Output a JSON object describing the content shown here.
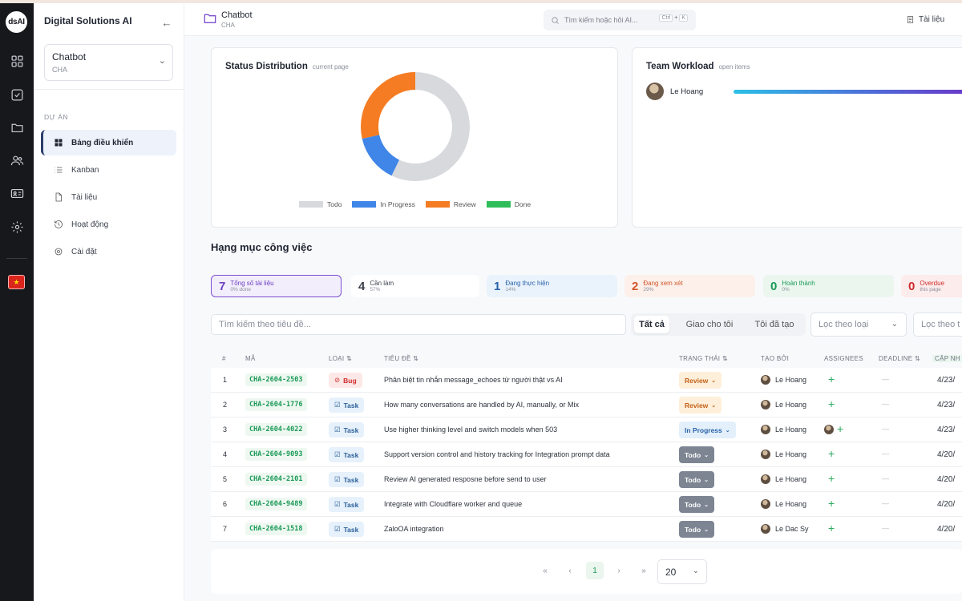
{
  "rail": {
    "logo": "dsAI",
    "icons": [
      "grid-icon",
      "check-square-icon",
      "folder-icon",
      "users-icon",
      "id-card-icon",
      "settings-icon"
    ],
    "flag": "vietnam-flag-icon"
  },
  "sidebar": {
    "org_name": "Digital Solutions AI",
    "project": {
      "name": "Chatbot",
      "code": "CHA"
    },
    "section_label": "DỰ ÁN",
    "items": [
      {
        "label": "Bảng điều khiển",
        "icon": "dashboard-icon",
        "active": true
      },
      {
        "label": "Kanban",
        "icon": "list-icon"
      },
      {
        "label": "Tài liệu",
        "icon": "document-icon"
      },
      {
        "label": "Hoạt động",
        "icon": "history-icon"
      },
      {
        "label": "Cài đặt",
        "icon": "gear-icon"
      }
    ]
  },
  "topbar": {
    "title": "Chatbot",
    "subtitle": "CHA",
    "search_placeholder": "Tìm kiếm hoặc hỏi AI...",
    "kbd": [
      "Ctrl",
      "+",
      "K"
    ],
    "docs_label": "Tài liệu"
  },
  "status_card": {
    "title": "Status Distribution",
    "subtitle": "current page"
  },
  "workload_card": {
    "title": "Team Workload",
    "subtitle": "open items",
    "rows": [
      {
        "name": "Le Hoang",
        "fraction": 1.0
      }
    ]
  },
  "chart_data": {
    "type": "pie",
    "title": "Status Distribution",
    "categories": [
      "Todo",
      "In Progress",
      "Review",
      "Done"
    ],
    "values": [
      4,
      1,
      2,
      0
    ],
    "colors": [
      "#d7d9dd",
      "#3f86e8",
      "#f57c23",
      "#2fbd5a"
    ],
    "legend": "bottom"
  },
  "section": {
    "title": "Hạng mục công việc"
  },
  "stats": [
    {
      "num": "7",
      "label": "Tổng số tài liệu",
      "sub": "0% done",
      "color": "#6b3fc0"
    },
    {
      "num": "4",
      "label": "Cần làm",
      "sub": "57%",
      "color": "#3a3f4a"
    },
    {
      "num": "1",
      "label": "Đang thực hiện",
      "sub": "14%",
      "color": "#2a62a8"
    },
    {
      "num": "2",
      "label": "Đang xem xét",
      "sub": "29%",
      "color": "#d1552a"
    },
    {
      "num": "0",
      "label": "Hoàn thành",
      "sub": "0%",
      "color": "#1b9a57"
    },
    {
      "num": "0",
      "label": "Overdue",
      "sub": "this page",
      "color": "#d12b2b"
    }
  ],
  "filters": {
    "search_placeholder": "Tìm kiếm theo tiêu đề...",
    "tabs": [
      "Tất cả",
      "Giao cho tôi",
      "Tôi đã tạo"
    ],
    "type_placeholder": "Lọc theo loại",
    "other_placeholder": "Lọc theo t"
  },
  "table": {
    "headers": [
      "#",
      "MÃ",
      "LOẠI ⇅",
      "TIÊU ĐỀ ⇅",
      "TRẠNG THÁI ⇅",
      "TẠO BỞI",
      "ASSIGNEES",
      "DEADLINE ⇅",
      "CẬP NH"
    ],
    "rows": [
      {
        "n": "1",
        "code": "CHA-2604-2503",
        "type": "Bug",
        "title": "Phân biệt tin nhắn message_echoes từ người thật vs AI",
        "status": "Review",
        "creator": "Le Hoang",
        "assignee": false,
        "deadline": "—",
        "updated": "4/23/"
      },
      {
        "n": "2",
        "code": "CHA-2604-1776",
        "type": "Task",
        "title": "How many conversations are handled by AI, manually, or Mix",
        "status": "Review",
        "creator": "Le Hoang",
        "assignee": false,
        "deadline": "—",
        "updated": "4/23/"
      },
      {
        "n": "3",
        "code": "CHA-2604-4022",
        "type": "Task",
        "title": "Use higher thinking level and switch models when 503",
        "status": "In Progress",
        "creator": "Le Hoang",
        "assignee": true,
        "deadline": "—",
        "updated": "4/23/"
      },
      {
        "n": "4",
        "code": "CHA-2604-9093",
        "type": "Task",
        "title": "Support version control and history tracking for Integration prompt data",
        "status": "Todo",
        "creator": "Le Hoang",
        "assignee": false,
        "deadline": "—",
        "updated": "4/20/"
      },
      {
        "n": "5",
        "code": "CHA-2604-2101",
        "type": "Task",
        "title": "Review AI generated resposne before send to user",
        "status": "Todo",
        "creator": "Le Hoang",
        "assignee": false,
        "deadline": "—",
        "updated": "4/20/"
      },
      {
        "n": "6",
        "code": "CHA-2604-9489",
        "type": "Task",
        "title": "Integrate with Cloudflare worker and queue",
        "status": "Todo",
        "creator": "Le Hoang",
        "assignee": false,
        "deadline": "—",
        "updated": "4/20/"
      },
      {
        "n": "7",
        "code": "CHA-2604-1518",
        "type": "Task",
        "title": "ZaloOA integration",
        "status": "Todo",
        "creator": "Le Dac Sy",
        "assignee": false,
        "deadline": "—",
        "updated": "4/20/"
      }
    ]
  },
  "pager": {
    "first": "«",
    "prev": "‹",
    "current": "1",
    "next": "›",
    "last": "»",
    "page_size": "20"
  }
}
